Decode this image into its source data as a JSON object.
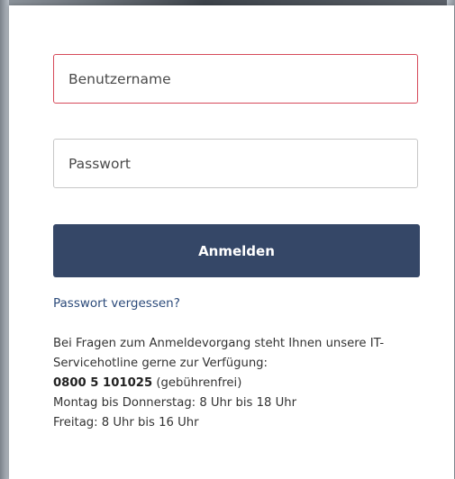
{
  "login_form": {
    "username_placeholder": "Benutzername",
    "password_placeholder": "Passwort",
    "submit_label": "Anmelden",
    "forgot_password_label": "Passwort vergessen?"
  },
  "support_info": {
    "line1": "Bei Fragen zum Anmeldevorgang steht Ihnen unsere IT-",
    "line2": "Servicehotline gerne zur Verfügung:",
    "hotline_number": "0800 5 101025",
    "hotline_note": " (gebührenfrei)",
    "hours_weekdays": "Montag bis Donnerstag: 8 Uhr bis 18 Uhr",
    "hours_friday": "Freitag: 8 Uhr bis 16 Uhr"
  },
  "colors": {
    "button_bg": "#354767",
    "username_border": "#d64a5a",
    "link": "#2b4a7a"
  }
}
